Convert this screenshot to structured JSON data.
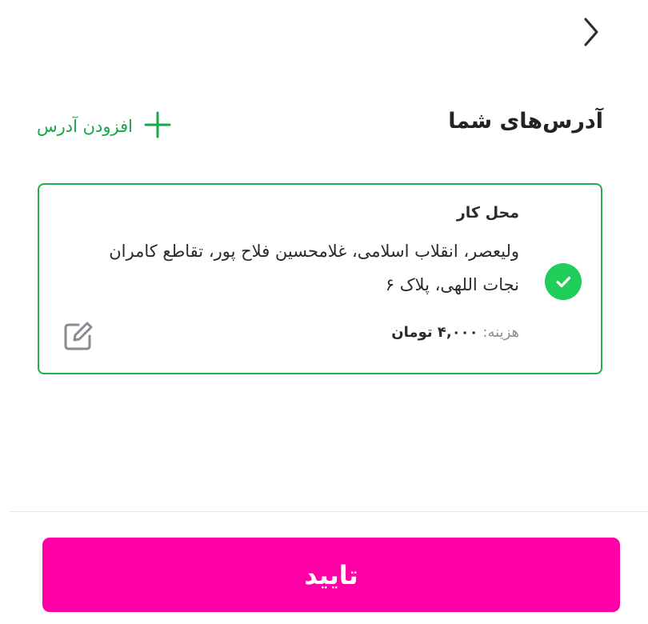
{
  "header": {
    "title": "آدرس‌های شما",
    "back_icon": "chevron-right-icon"
  },
  "add_address": {
    "label": "افزودن آدرس",
    "icon": "plus-icon"
  },
  "addresses": [
    {
      "title": "محل کار",
      "address": "ولیعصر، انقلاب اسلامی، غلامحسین فلاح پور، تقاطع کامران نجات اللهی، پلاک ۶",
      "cost_label": "هزینه:",
      "cost_value": "۴,۰۰۰ تومان",
      "selected": true
    }
  ],
  "footer": {
    "confirm_label": "تایید"
  },
  "colors": {
    "accent_green": "#1aa64c",
    "card_border": "#22b04b",
    "check_green": "#1fcf5a",
    "confirm_bg": "#ff00a6"
  }
}
